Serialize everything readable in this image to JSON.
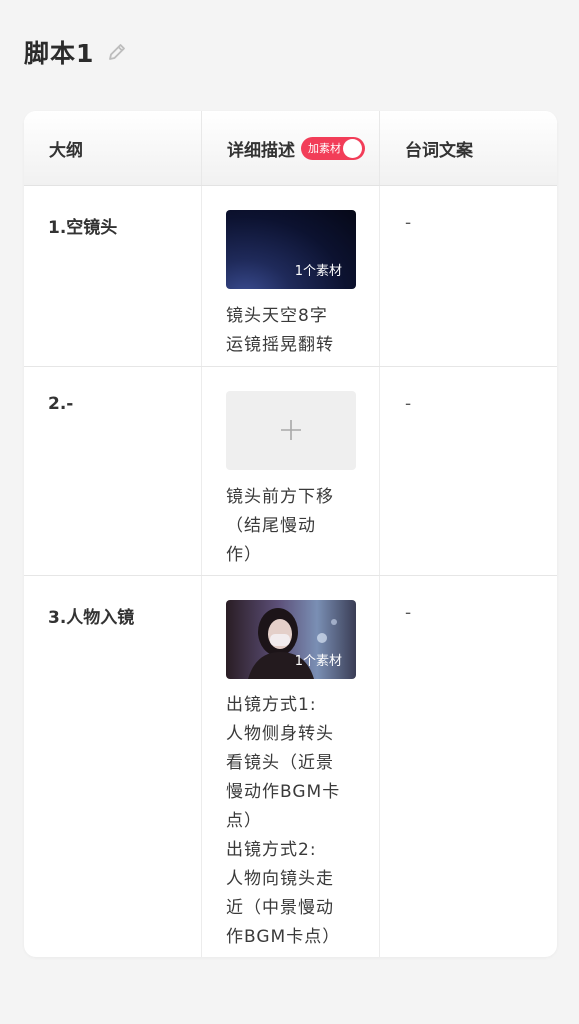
{
  "header": {
    "title": "脚本1"
  },
  "table": {
    "columns": {
      "outline": "大纲",
      "description": "详细描述",
      "toggle_label": "加素材",
      "lines": "台词文案"
    },
    "rows": [
      {
        "outline": "1.空镜头",
        "media_badge": "1个素材",
        "description": "镜头天空8字\n运镜摇晃翻转",
        "lines": "-"
      },
      {
        "outline": "2.-",
        "description": "镜头前方下移\n（结尾慢动\n作）",
        "lines": "-"
      },
      {
        "outline": "3.人物入镜",
        "media_badge": "1个素材",
        "description": "出镜方式1:\n人物侧身转头\n看镜头（近景\n慢动作BGM卡\n点）\n出镜方式2:\n人物向镜头走\n近（中景慢动\n作BGM卡点）",
        "lines": "-"
      }
    ]
  },
  "colors": {
    "accent": "#f23d58",
    "background": "#f4f4f4"
  },
  "icons": {
    "edit": "pencil-icon",
    "add": "plus-icon"
  }
}
